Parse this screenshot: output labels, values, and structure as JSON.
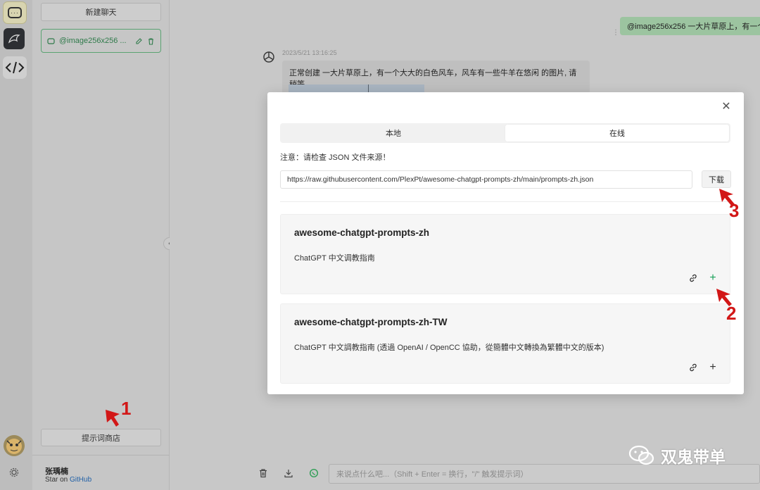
{
  "sidebar": {
    "new_chat": "新建聊天",
    "chat_items": [
      {
        "title": "@image256x256 ..."
      }
    ],
    "prompt_store": "提示词商店",
    "user_name": "张瑀楠",
    "star_prefix": "Star on",
    "star_link": "GitHub"
  },
  "conversation": {
    "user_message": "@image256x256 一大片草原上，有一个",
    "timestamp": "2023/5/21 13:16:25",
    "bot_message": "正常创建 一大片草原上，有一个大大的白色风车，风车有一些牛羊在悠闲 的图片, 请稍等..."
  },
  "input": {
    "placeholder": "来说点什么吧...（Shift + Enter = 换行，\"/\" 触发提示词）"
  },
  "modal": {
    "tabs": [
      "本地",
      "在线"
    ],
    "active_tab": "在线",
    "notice": "注意：请检查 JSON 文件来源！",
    "url_value": "https://raw.githubusercontent.com/PlexPt/awesome-chatgpt-prompts-zh/main/prompts-zh.json",
    "download_label": "下载",
    "cards": [
      {
        "title": "awesome-chatgpt-prompts-zh",
        "desc": "ChatGPT 中文调教指南",
        "add": "+"
      },
      {
        "title": "awesome-chatgpt-prompts-zh-TW",
        "desc": "ChatGPT 中文調教指南 (透過 OpenAI / OpenCC 協助，從簡體中文轉換為繁體中文的版本)",
        "add": "+"
      }
    ]
  },
  "annotations": [
    "1",
    "2",
    "3"
  ],
  "watermark": "双鬼带单",
  "colors": {
    "accent_green": "#18a058",
    "annotation_red": "#d21717"
  }
}
